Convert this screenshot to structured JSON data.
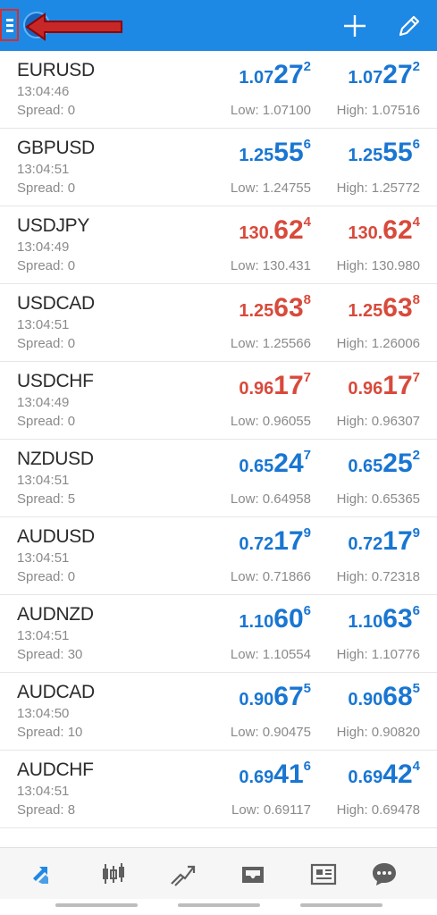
{
  "quotes": [
    {
      "symbol": "EURUSD",
      "time": "13:04:46",
      "spread": "Spread: 0",
      "color": "#1976d2",
      "bid": {
        "base": "1.07",
        "big": "27",
        "sup": "2"
      },
      "ask": {
        "base": "1.07",
        "big": "27",
        "sup": "2"
      },
      "low": "Low: 1.07100",
      "high": "High: 1.07516"
    },
    {
      "symbol": "GBPUSD",
      "time": "13:04:51",
      "spread": "Spread: 0",
      "color": "#1976d2",
      "bid": {
        "base": "1.25",
        "big": "55",
        "sup": "6"
      },
      "ask": {
        "base": "1.25",
        "big": "55",
        "sup": "6"
      },
      "low": "Low: 1.24755",
      "high": "High: 1.25772"
    },
    {
      "symbol": "USDJPY",
      "time": "13:04:49",
      "spread": "Spread: 0",
      "color": "#d84a3b",
      "bid": {
        "base": "130.",
        "big": "62",
        "sup": "4"
      },
      "ask": {
        "base": "130.",
        "big": "62",
        "sup": "4"
      },
      "low": "Low: 130.431",
      "high": "High: 130.980"
    },
    {
      "symbol": "USDCAD",
      "time": "13:04:51",
      "spread": "Spread: 0",
      "color": "#d84a3b",
      "bid": {
        "base": "1.25",
        "big": "63",
        "sup": "8"
      },
      "ask": {
        "base": "1.25",
        "big": "63",
        "sup": "8"
      },
      "low": "Low: 1.25566",
      "high": "High: 1.26006"
    },
    {
      "symbol": "USDCHF",
      "time": "13:04:49",
      "spread": "Spread: 0",
      "color": "#d84a3b",
      "bid": {
        "base": "0.96",
        "big": "17",
        "sup": "7"
      },
      "ask": {
        "base": "0.96",
        "big": "17",
        "sup": "7"
      },
      "low": "Low: 0.96055",
      "high": "High: 0.96307"
    },
    {
      "symbol": "NZDUSD",
      "time": "13:04:51",
      "spread": "Spread: 5",
      "color": "#1976d2",
      "bid": {
        "base": "0.65",
        "big": "24",
        "sup": "7"
      },
      "ask": {
        "base": "0.65",
        "big": "25",
        "sup": "2"
      },
      "low": "Low: 0.64958",
      "high": "High: 0.65365"
    },
    {
      "symbol": "AUDUSD",
      "time": "13:04:51",
      "spread": "Spread: 0",
      "color": "#1976d2",
      "bid": {
        "base": "0.72",
        "big": "17",
        "sup": "9"
      },
      "ask": {
        "base": "0.72",
        "big": "17",
        "sup": "9"
      },
      "low": "Low: 0.71866",
      "high": "High: 0.72318"
    },
    {
      "symbol": "AUDNZD",
      "time": "13:04:51",
      "spread": "Spread: 30",
      "color": "#1976d2",
      "bid": {
        "base": "1.10",
        "big": "60",
        "sup": "6"
      },
      "ask": {
        "base": "1.10",
        "big": "63",
        "sup": "6"
      },
      "low": "Low: 1.10554",
      "high": "High: 1.10776"
    },
    {
      "symbol": "AUDCAD",
      "time": "13:04:50",
      "spread": "Spread: 10",
      "color": "#1976d2",
      "bid": {
        "base": "0.90",
        "big": "67",
        "sup": "5"
      },
      "ask": {
        "base": "0.90",
        "big": "68",
        "sup": "5"
      },
      "low": "Low: 0.90475",
      "high": "High: 0.90820"
    },
    {
      "symbol": "AUDCHF",
      "time": "13:04:51",
      "spread": "Spread: 8",
      "color": "#1976d2",
      "bid": {
        "base": "0.69",
        "big": "41",
        "sup": "6"
      },
      "ask": {
        "base": "0.69",
        "big": "42",
        "sup": "4"
      },
      "low": "Low: 0.69117",
      "high": "High: 0.69478"
    }
  ],
  "header": {
    "background": "#1e88e5",
    "icons": [
      "menu-icon",
      "app-logo",
      "add-icon",
      "edit-icon"
    ],
    "annotation_color": "#d32f2f"
  },
  "bottom_nav": {
    "items": [
      "quotes-icon",
      "chart-icon",
      "trade-icon",
      "history-icon",
      "news-icon",
      "chat-icon"
    ],
    "active": "quotes-icon",
    "active_color": "#1e88e5",
    "inactive_color": "#5f5f5f"
  }
}
